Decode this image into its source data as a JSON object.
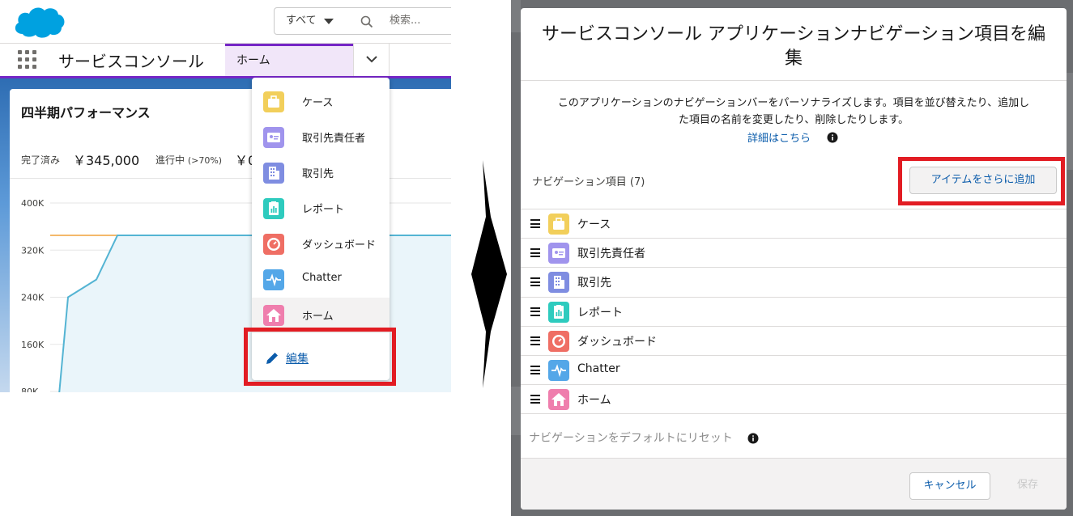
{
  "header": {
    "search_scope": "すべて",
    "search_placeholder": "検索..."
  },
  "nav": {
    "app_name": "サービスコンソール",
    "active_tab": "ホーム"
  },
  "card": {
    "title": "四半期パフォーマンス",
    "done_label": "完了済み",
    "done_value": "￥345,000",
    "progress_label": "進行中",
    "progress_note": "(>70%)",
    "progress_value": "￥0"
  },
  "chart_data": {
    "type": "area",
    "x": [
      0,
      1,
      2,
      3,
      4
    ],
    "y_ticks": [
      "400K",
      "320K",
      "240K",
      "160K",
      "80K"
    ],
    "series": [
      {
        "values": [
          0,
          240000,
          270000,
          345000,
          345000
        ]
      }
    ],
    "target": 345000,
    "ylim": [
      80000,
      400000
    ],
    "colors": {
      "line": "#54b4d3",
      "fill": "#eaf5fa",
      "target": "#f4b96b"
    }
  },
  "menu": {
    "items": [
      {
        "label": "ケース",
        "icon": "briefcase-icon",
        "color": "#f2cf5b"
      },
      {
        "label": "取引先責任者",
        "icon": "contact-card-icon",
        "color": "#a094ed"
      },
      {
        "label": "取引先",
        "icon": "building-icon",
        "color": "#7f8de1"
      },
      {
        "label": "レポート",
        "icon": "report-icon",
        "color": "#2ecbbe"
      },
      {
        "label": "ダッシュボード",
        "icon": "gauge-icon",
        "color": "#ef6e64"
      },
      {
        "label": "Chatter",
        "icon": "pulse-icon",
        "color": "#54a7e8"
      },
      {
        "label": "ホーム",
        "icon": "home-icon",
        "color": "#ef7ead"
      }
    ],
    "edit_label": "編集"
  },
  "modal": {
    "title": "サービスコンソール アプリケーションナビゲーション項目を編集",
    "description_line1": "このアプリケーションのナビゲーションバーをパーソナライズします。項目を並び替えたり、追加し",
    "description_line2": "た項目の名前を変更したり、削除したりします。",
    "learn_more": "詳細はこちら",
    "nav_items_label": "ナビゲーション項目 (7)",
    "add_button": "アイテムをさらに追加",
    "rows": [
      {
        "label": "ケース"
      },
      {
        "label": "取引先責任者"
      },
      {
        "label": "取引先"
      },
      {
        "label": "レポート"
      },
      {
        "label": "ダッシュボード"
      },
      {
        "label": "Chatter"
      },
      {
        "label": "ホーム"
      }
    ],
    "reset_label": "ナビゲーションをデフォルトにリセット",
    "cancel_button": "キャンセル",
    "save_button": "保存"
  }
}
